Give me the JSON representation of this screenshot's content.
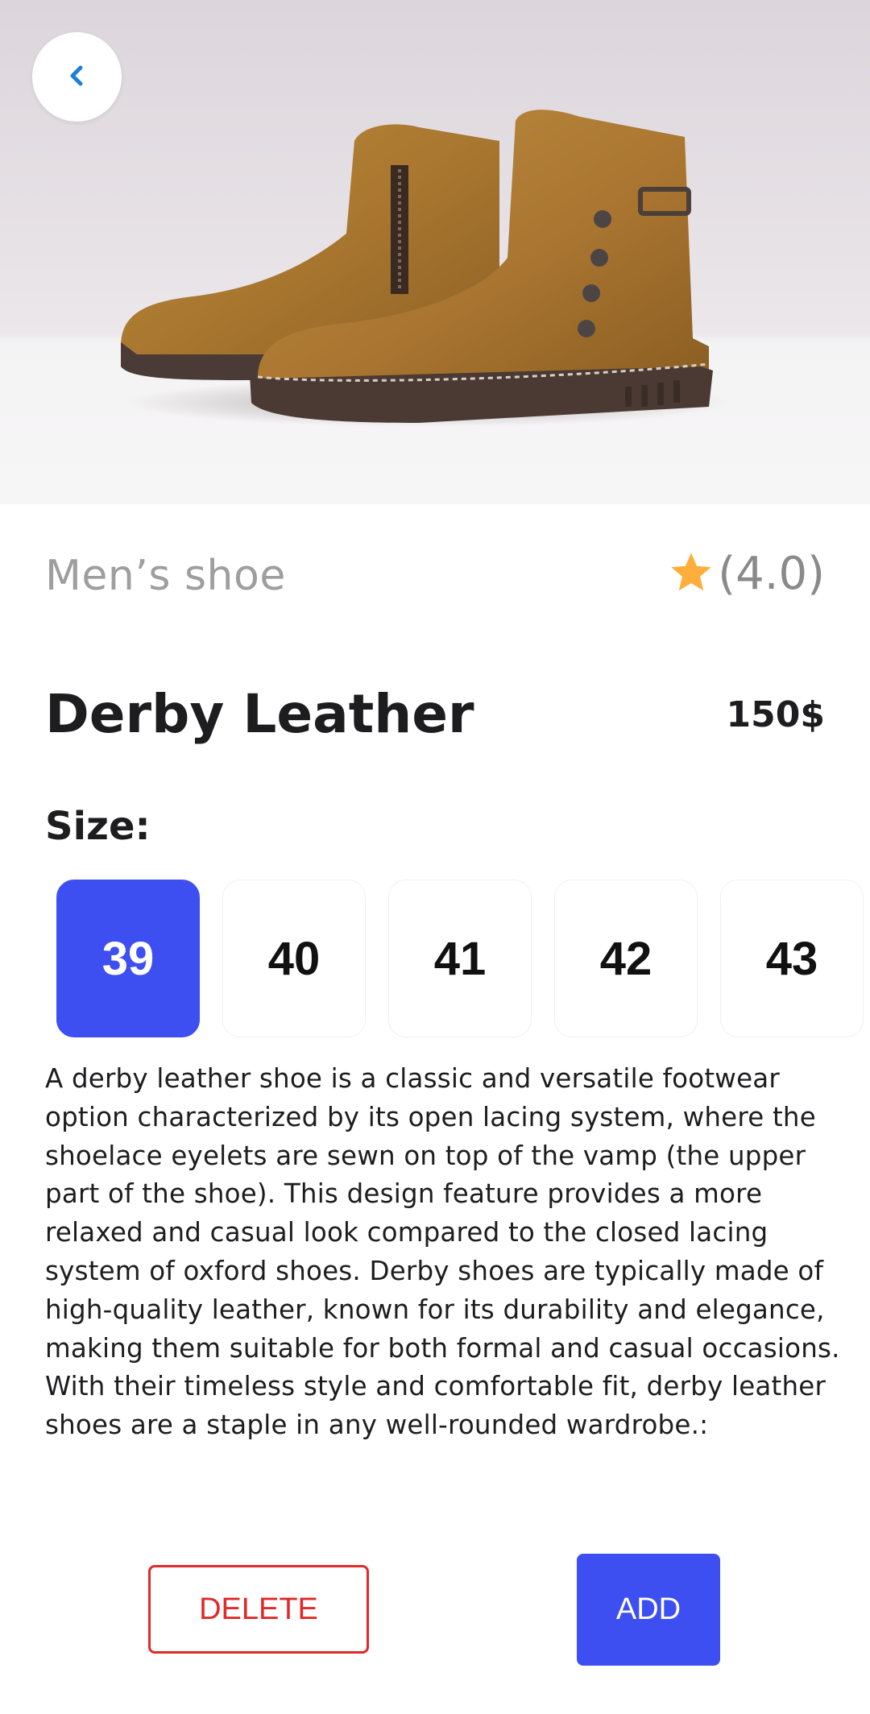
{
  "product": {
    "category": "Men’s shoe",
    "rating": "(4.0)",
    "name": "Derby Leather",
    "price": "150$",
    "image_subject": "brown suede ankle boots"
  },
  "size": {
    "label": "Size:",
    "options": [
      "39",
      "40",
      "41",
      "42",
      "43"
    ],
    "selected": "39"
  },
  "description": "A derby leather shoe is a classic and versatile footwear option characterized by its open lacing system, where the shoelace eyelets are sewn on top of the vamp (the upper part of the shoe). This design feature provides a more relaxed and casual look compared to the closed lacing system of oxford shoes. Derby shoes are typically made of high-quality leather, known for its durability and elegance, making them suitable for both formal and casual occasions. With their timeless style and comfortable fit, derby leather shoes are a staple in any well-rounded wardrobe.:",
  "actions": {
    "delete_label": "DELETE",
    "add_label": "ADD"
  },
  "icons": {
    "back": "chevron-left-icon",
    "rating": "star-icon"
  },
  "colors": {
    "accent": "#3d4ff1",
    "danger": "#e02a2a",
    "star": "#ffad3b",
    "back_chevron": "#1f7fd6",
    "muted_text": "#9e9e9e"
  }
}
